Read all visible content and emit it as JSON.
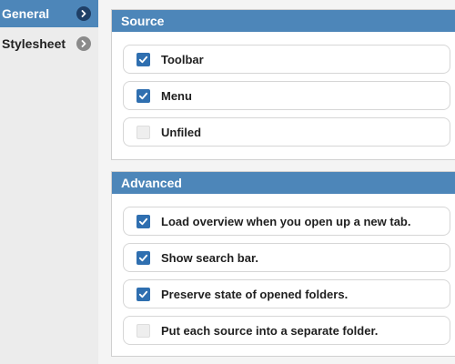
{
  "sidebar": {
    "items": [
      {
        "label": "General",
        "active": true,
        "icon": "chevron-right-icon"
      },
      {
        "label": "Stylesheet",
        "active": false,
        "icon": "chevron-right-icon"
      }
    ]
  },
  "source": {
    "title": "Source",
    "options": [
      {
        "label": "Toolbar",
        "checked": true
      },
      {
        "label": "Menu",
        "checked": true
      },
      {
        "label": "Unfiled",
        "checked": false
      }
    ]
  },
  "advanced": {
    "title": "Advanced",
    "options": [
      {
        "label": "Load overview when you open up a new tab.",
        "checked": true
      },
      {
        "label": "Show search bar.",
        "checked": true
      },
      {
        "label": "Preserve state of opened folders.",
        "checked": true
      },
      {
        "label": "Put each source into a separate folder.",
        "checked": false
      }
    ]
  },
  "colors": {
    "accent": "#4d86b9",
    "checkbox_checked": "#2f6fb0",
    "active_chevron_bg": "#1f3f66",
    "inactive_chevron_bg": "#8a8a8a"
  }
}
